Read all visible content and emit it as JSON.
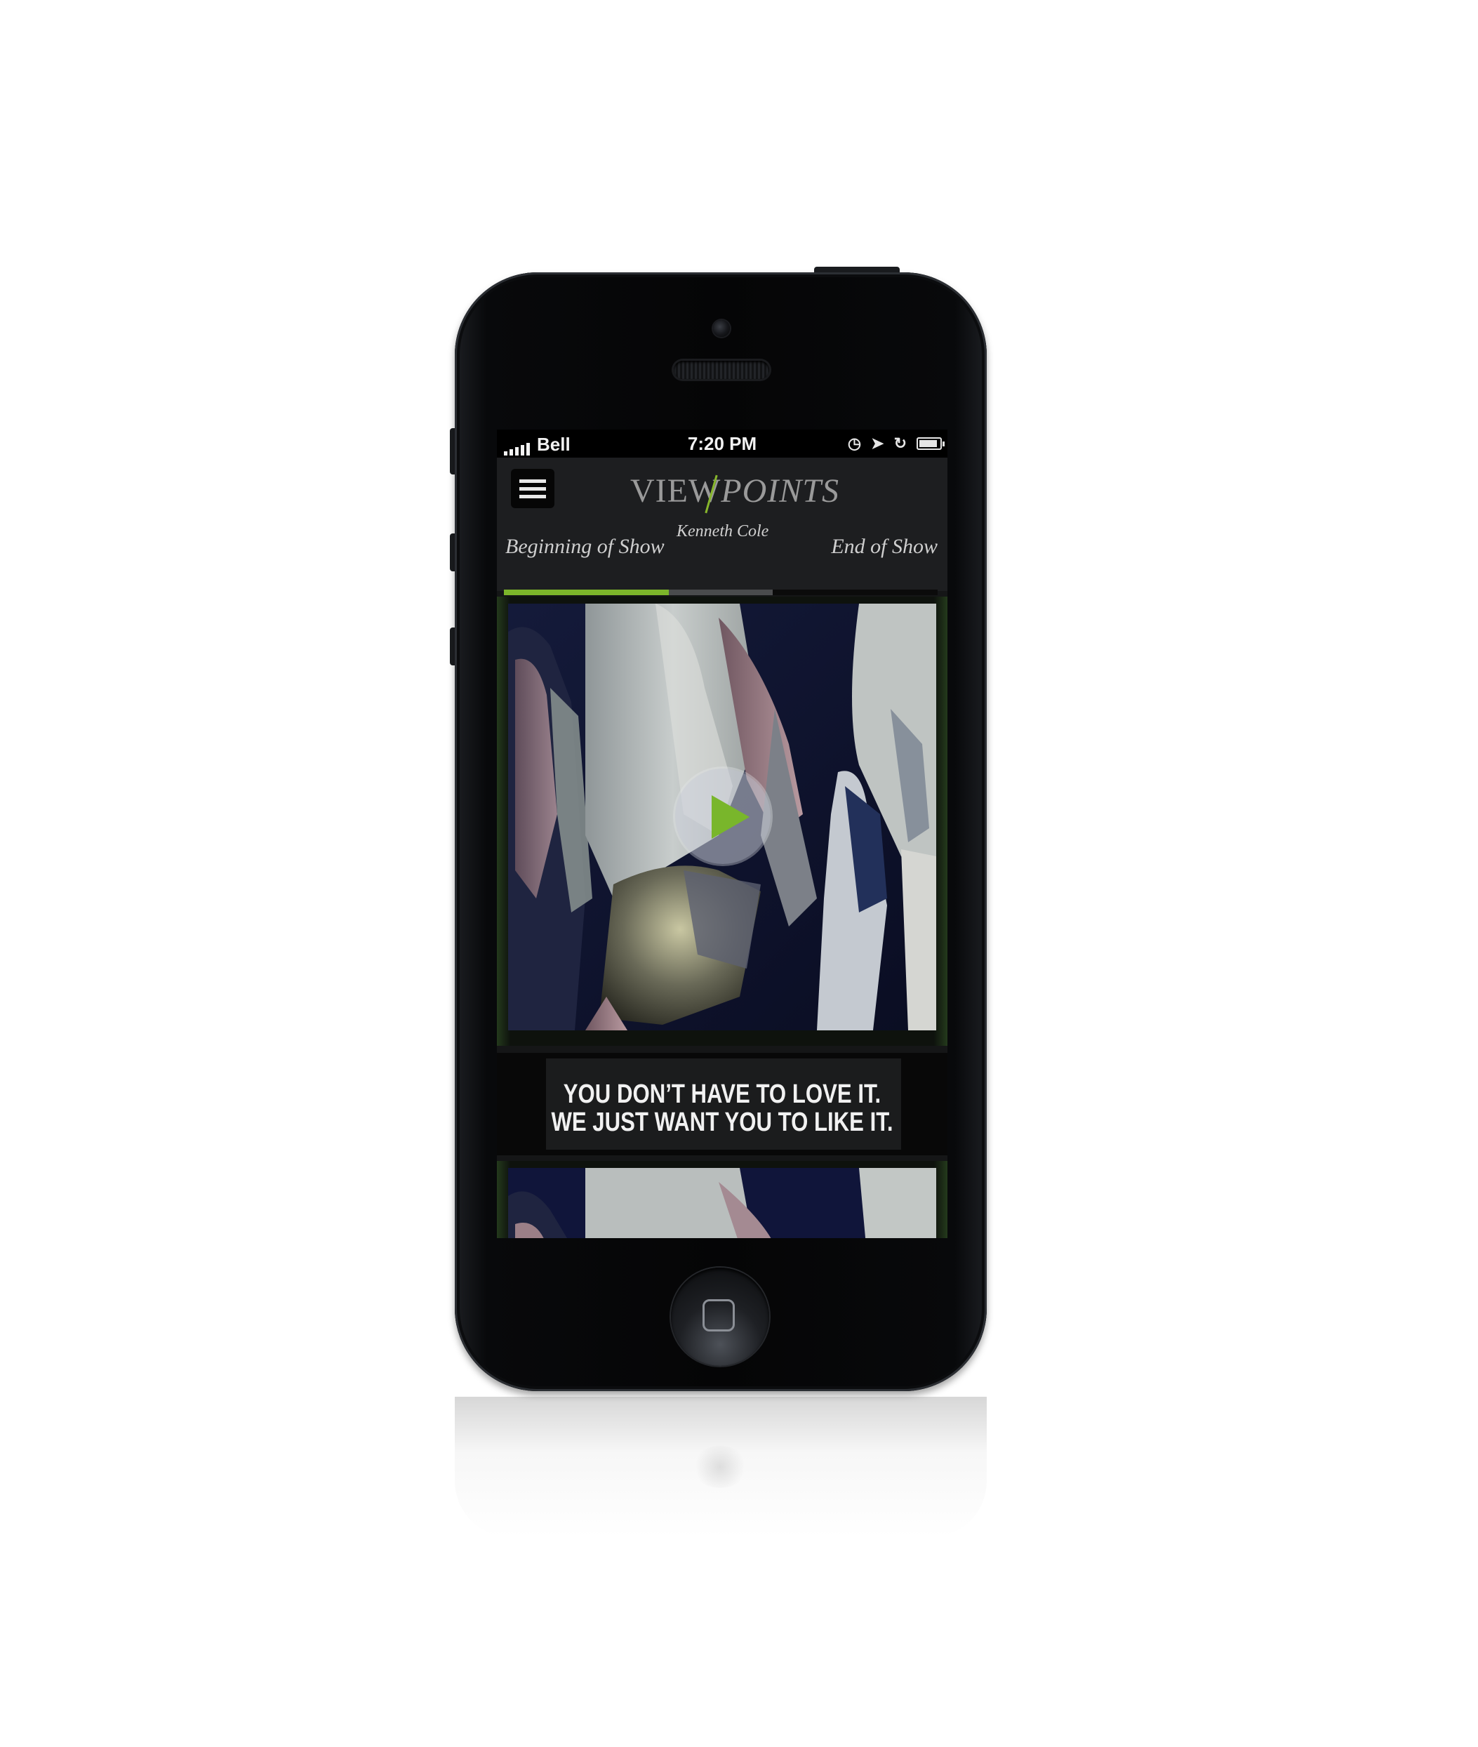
{
  "status_bar": {
    "carrier": "Bell",
    "time": "7:20 PM",
    "signal_bars": 5,
    "battery_level": 0.9
  },
  "header": {
    "logo_left": "VIEW",
    "logo_right": "POINTS",
    "brand_signature": "Kenneth Cole",
    "start_label": "Beginning of Show",
    "end_label": "End of Show",
    "progress_played": 0.38,
    "progress_buffered": 0.62,
    "accent_color": "#7cb52a"
  },
  "video_card": {
    "play_icon": "play-icon"
  },
  "caption": {
    "line1": "YOU DON’T HAVE TO LOVE IT.",
    "line2": "WE JUST WANT YOU TO LIKE IT."
  },
  "icons": {
    "menu": "hamburger-menu-icon",
    "clock": "alarm-clock-icon",
    "location": "location-arrow-icon",
    "rotation_lock": "rotation-lock-icon",
    "battery": "battery-icon",
    "home": "home-button-icon"
  }
}
